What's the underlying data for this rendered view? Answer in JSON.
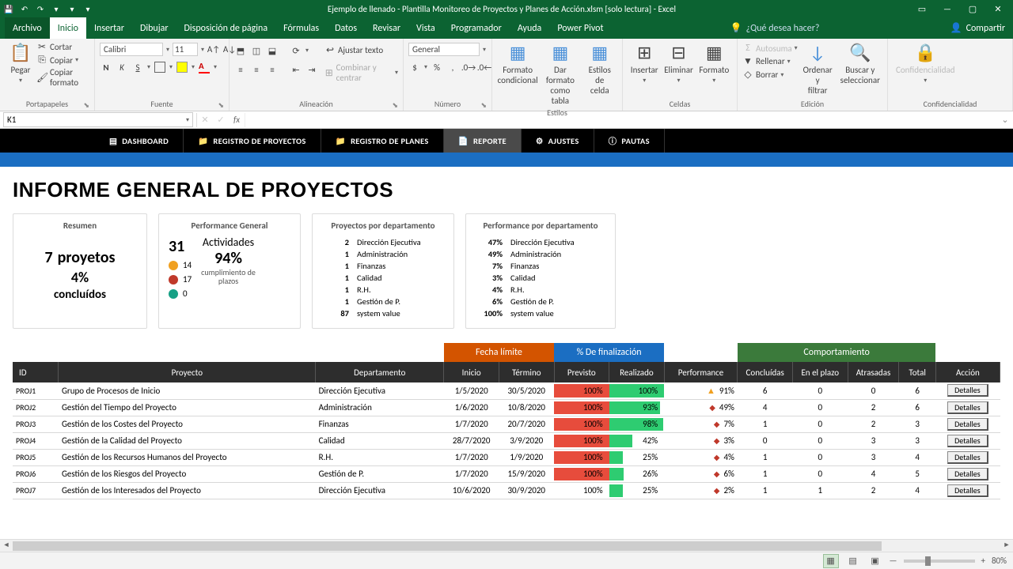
{
  "window": {
    "title": "Ejemplo de llenado - Plantilla Monitoreo de Proyectos y Planes de Acción.xlsm  [solo lectura]  -  Excel",
    "share": "Compartir"
  },
  "menu": {
    "file": "Archivo",
    "items": [
      "Inicio",
      "Insertar",
      "Dibujar",
      "Disposición de página",
      "Fórmulas",
      "Datos",
      "Revisar",
      "Vista",
      "Programador",
      "Ayuda",
      "Power Pivot"
    ],
    "active": 0,
    "tellme": "¿Qué desea hacer?"
  },
  "ribbon": {
    "clipboard": {
      "paste": "Pegar",
      "cut": "Cortar",
      "copy": "Copiar",
      "format_painter": "Copiar formato",
      "label": "Portapapeles"
    },
    "font": {
      "name": "Calibri",
      "size": "11",
      "label": "Fuente"
    },
    "align": {
      "wrap": "Ajustar texto",
      "merge": "Combinar y centrar",
      "label": "Alineación"
    },
    "number": {
      "format": "General",
      "label": "Número"
    },
    "styles": {
      "cond": "Formato\ncondicional",
      "table": "Dar formato\ncomo tabla",
      "cell": "Estilos de\ncelda",
      "label": "Estilos"
    },
    "cells": {
      "insert": "Insertar",
      "delete": "Eliminar",
      "format": "Formato",
      "label": "Celdas"
    },
    "editing": {
      "sum": "Autosuma",
      "fill": "Rellenar",
      "clear": "Borrar",
      "sort": "Ordenar y\nfiltrar",
      "find": "Buscar y\nseleccionar",
      "label": "Edición"
    },
    "sensitivity": {
      "btn": "Confidencialidad",
      "label": "Confidencialidad"
    }
  },
  "formula": {
    "ref": "K1"
  },
  "nav": {
    "tabs": [
      "DASHBOARD",
      "REGISTRO DE PROYECTOS",
      "REGISTRO DE PLANES",
      "REPORTE",
      "AJUSTES",
      "PAUTAS"
    ],
    "icons": [
      "▤",
      "📁",
      "📁",
      "📄",
      "⚙",
      "ⓘ"
    ],
    "active": 3
  },
  "report": {
    "title": "INFORME GENERAL DE PROYECTOS",
    "resumen": {
      "label": "Resumen",
      "count": "7",
      "word": "proyetos",
      "pct": "4%",
      "concl": "concluídos"
    },
    "perf_general": {
      "label": "Performance General",
      "count": "31",
      "acts": "Actividades",
      "pct": "94%",
      "sub": "cumplimiento de\nplazos",
      "rows": [
        {
          "c": "orange",
          "n": "14"
        },
        {
          "c": "red",
          "n": "17"
        },
        {
          "c": "teal",
          "n": "0"
        }
      ]
    },
    "dept_projects": {
      "label": "Proyectos por departamento",
      "rows": [
        {
          "n": "2",
          "l": "Dirección Ejecutiva"
        },
        {
          "n": "1",
          "l": "Administración"
        },
        {
          "n": "1",
          "l": "Finanzas"
        },
        {
          "n": "1",
          "l": "Calidad"
        },
        {
          "n": "1",
          "l": "R.H."
        },
        {
          "n": "1",
          "l": "Gestión de P."
        },
        {
          "n": "87",
          "l": "system value"
        }
      ]
    },
    "dept_perf": {
      "label": "Performance por departamento",
      "rows": [
        {
          "n": "47%",
          "l": "Dirección Ejecutiva"
        },
        {
          "n": "49%",
          "l": "Administración"
        },
        {
          "n": "7%",
          "l": "Finanzas"
        },
        {
          "n": "3%",
          "l": "Calidad"
        },
        {
          "n": "4%",
          "l": "R.H."
        },
        {
          "n": "6%",
          "l": "Gestión de P."
        },
        {
          "n": "100%",
          "l": "system value"
        }
      ]
    }
  },
  "table": {
    "band_fecha": "Fecha límite",
    "band_final": "% De finalización",
    "band_comp": "Comportamiento",
    "cols": [
      "ID",
      "Proyecto",
      "Departamento",
      "Inicio",
      "Término",
      "Previsto",
      "Realizado",
      "Performance",
      "Concluídas",
      "En el plazo",
      "Atrasadas",
      "Total",
      "Acción"
    ],
    "action_btn": "Detalles",
    "rows": [
      {
        "id": "PROJ1",
        "proj": "Grupo de Procesos de Inicio",
        "dept": "Dirección Ejecutiva",
        "ini": "1/5/2020",
        "fin": "30/5/2020",
        "prev": 100,
        "real": 100,
        "ind": "tri",
        "perf": "91%",
        "c": 6,
        "ep": 0,
        "at": 0,
        "t": 6
      },
      {
        "id": "PROJ2",
        "proj": "Gestión del Tiempo del Proyecto",
        "dept": "Administración",
        "ini": "1/6/2020",
        "fin": "10/8/2020",
        "prev": 100,
        "real": 93,
        "ind": "diamond",
        "perf": "49%",
        "c": 4,
        "ep": 0,
        "at": 2,
        "t": 6
      },
      {
        "id": "PROJ3",
        "proj": "Gestión de los Costes del Proyecto",
        "dept": "Finanzas",
        "ini": "1/7/2020",
        "fin": "20/7/2020",
        "prev": 100,
        "real": 98,
        "ind": "diamond",
        "perf": "7%",
        "c": 1,
        "ep": 0,
        "at": 2,
        "t": 3
      },
      {
        "id": "PROJ4",
        "proj": "Gestión de la Calidad del Proyecto",
        "dept": "Calidad",
        "ini": "28/7/2020",
        "fin": "3/9/2020",
        "prev": 100,
        "real": 42,
        "ind": "diamond",
        "perf": "3%",
        "c": 0,
        "ep": 0,
        "at": 3,
        "t": 3
      },
      {
        "id": "PROJ5",
        "proj": "Gestión de los Recursos Humanos del Proyecto",
        "dept": "R.H.",
        "ini": "1/7/2020",
        "fin": "1/9/2020",
        "prev": 100,
        "real": 25,
        "ind": "diamond",
        "perf": "4%",
        "c": 1,
        "ep": 0,
        "at": 3,
        "t": 4
      },
      {
        "id": "PROJ6",
        "proj": "Gestión de los Riesgos del Proyecto",
        "dept": "Gestión de P.",
        "ini": "1/7/2020",
        "fin": "15/9/2020",
        "prev": 100,
        "real": 26,
        "ind": "diamond",
        "perf": "6%",
        "c": 1,
        "ep": 0,
        "at": 4,
        "t": 5
      },
      {
        "id": "PROJ7",
        "proj": "Gestión de los Interesados del Proyecto",
        "dept": "Dirección Ejecutiva",
        "ini": "10/6/2020",
        "fin": "30/9/2020",
        "prev": 100,
        "prev_red": false,
        "real": 25,
        "ind": "diamond",
        "perf": "2%",
        "c": 1,
        "ep": 1,
        "at": 2,
        "t": 4
      }
    ]
  },
  "status": {
    "zoom": "80%"
  }
}
